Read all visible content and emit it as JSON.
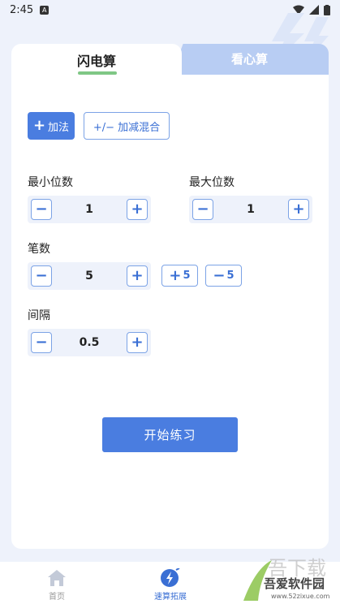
{
  "status": {
    "time": "2:45",
    "notif": "A"
  },
  "tabs": {
    "active": "闪电算",
    "inactive": "看心算"
  },
  "ops": {
    "add": "加法",
    "mix": "+/− 加减混合"
  },
  "min_digits": {
    "label": "最小位数",
    "value": "1"
  },
  "max_digits": {
    "label": "最大位数",
    "value": "1"
  },
  "count": {
    "label": "笔数",
    "value": "5",
    "plus5": "5",
    "minus5": "5"
  },
  "interval": {
    "label": "间隔",
    "value": "0.5"
  },
  "start": "开始练习",
  "nav": {
    "home": "首页",
    "speed": "速算拓展"
  },
  "watermark": {
    "text": "吾爱软件园",
    "url": "www.52zixue.com"
  },
  "colors": {
    "accent": "#4a7de0",
    "tab_inactive": "#b8cdf3",
    "underline": "#7fc785"
  }
}
